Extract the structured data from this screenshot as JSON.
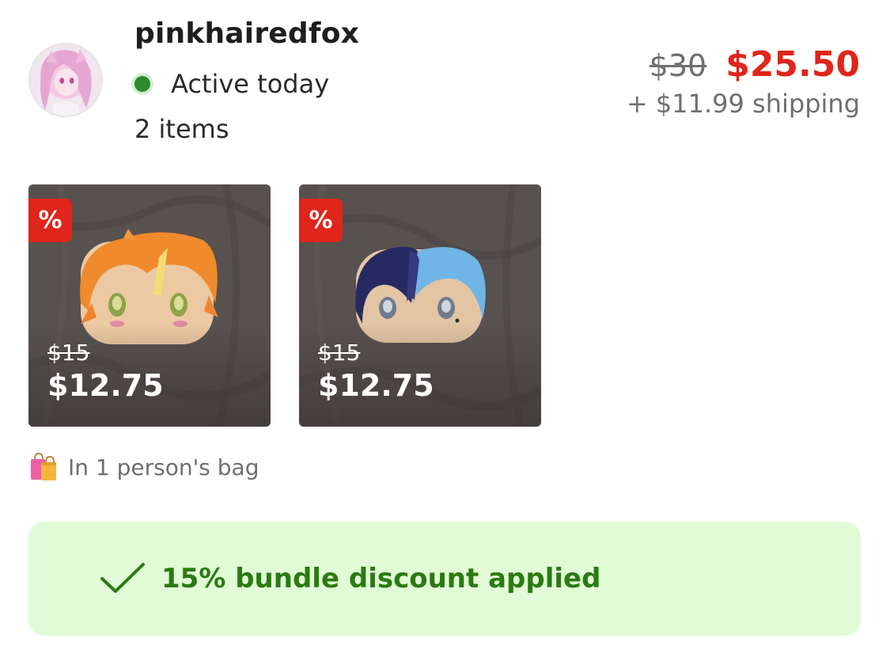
{
  "seller": {
    "username": "pinkhairedfox",
    "status": "Active today",
    "items_count": "2 items",
    "status_color": "#2e8b2e"
  },
  "price": {
    "original": "$30",
    "sale": "$25.50",
    "shipping": "+ $11.99 shipping",
    "sale_color": "#e0251b"
  },
  "items": [
    {
      "badge": "%",
      "original_price": "$15",
      "sale_price": "$12.75",
      "photo": "orange-hair-plush"
    },
    {
      "badge": "%",
      "original_price": "$15",
      "sale_price": "$12.75",
      "photo": "blue-hair-plush"
    }
  ],
  "bag": {
    "icon": "shopping-bags-icon",
    "text": "In 1 person's bag"
  },
  "bundle": {
    "icon": "check-icon",
    "text": "15% bundle discount applied",
    "background_color": "#e1fbd6",
    "text_color": "#2b7a12"
  }
}
